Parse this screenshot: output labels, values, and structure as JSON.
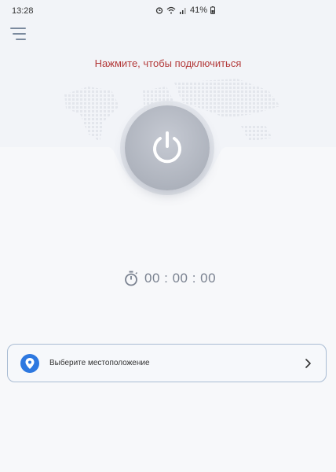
{
  "status_bar": {
    "time": "13:28",
    "battery": "41%"
  },
  "prompt": "Нажмите, чтобы подключиться",
  "timer": "00 : 00 : 00",
  "location": {
    "label": "Выберите местоположение"
  },
  "colors": {
    "accent": "#2d78e0",
    "prompt": "#b33a3a",
    "button": "#b0b5bf",
    "border": "#a9bcd3"
  },
  "icons": [
    "menu-icon",
    "power-icon",
    "stopwatch-icon",
    "location-pin-icon",
    "chevron-right-icon"
  ]
}
